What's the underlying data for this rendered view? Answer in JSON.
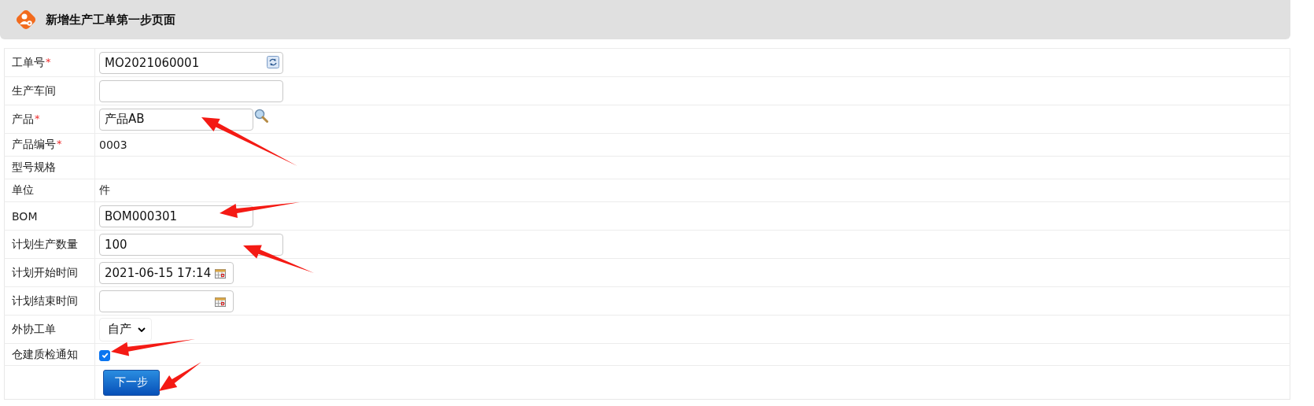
{
  "header": {
    "title": "新增生产工单第一步页面"
  },
  "rows": [
    {
      "kind": "code-input",
      "label": "工单号",
      "required_mark": "*",
      "value": "MO2021060001",
      "wide": true
    },
    {
      "kind": "input",
      "label": "生产车间",
      "wide": true
    },
    {
      "kind": "lookup-input",
      "label": "产品",
      "required_mark": "*",
      "value": "产品AB",
      "wide": false
    },
    {
      "kind": "static",
      "label": "产品编号",
      "required_mark": "*",
      "value": "0003"
    },
    {
      "kind": "static",
      "label": "型号规格"
    },
    {
      "kind": "static",
      "label": "单位",
      "value": "件"
    },
    {
      "kind": "input",
      "label": "BOM",
      "value": "BOM000301",
      "wide": false
    },
    {
      "kind": "input",
      "label": "计划生产数量",
      "value": "100",
      "wide": true
    },
    {
      "kind": "date",
      "label": "计划开始时间",
      "value": "2021-06-15 17:14"
    },
    {
      "kind": "date",
      "label": "计划结束时间"
    },
    {
      "kind": "select",
      "label": "外协工单",
      "value": "自产"
    },
    {
      "kind": "checkbox",
      "label": "仓建质检通知",
      "checked": true
    }
  ],
  "button": {
    "label": "下一步"
  }
}
